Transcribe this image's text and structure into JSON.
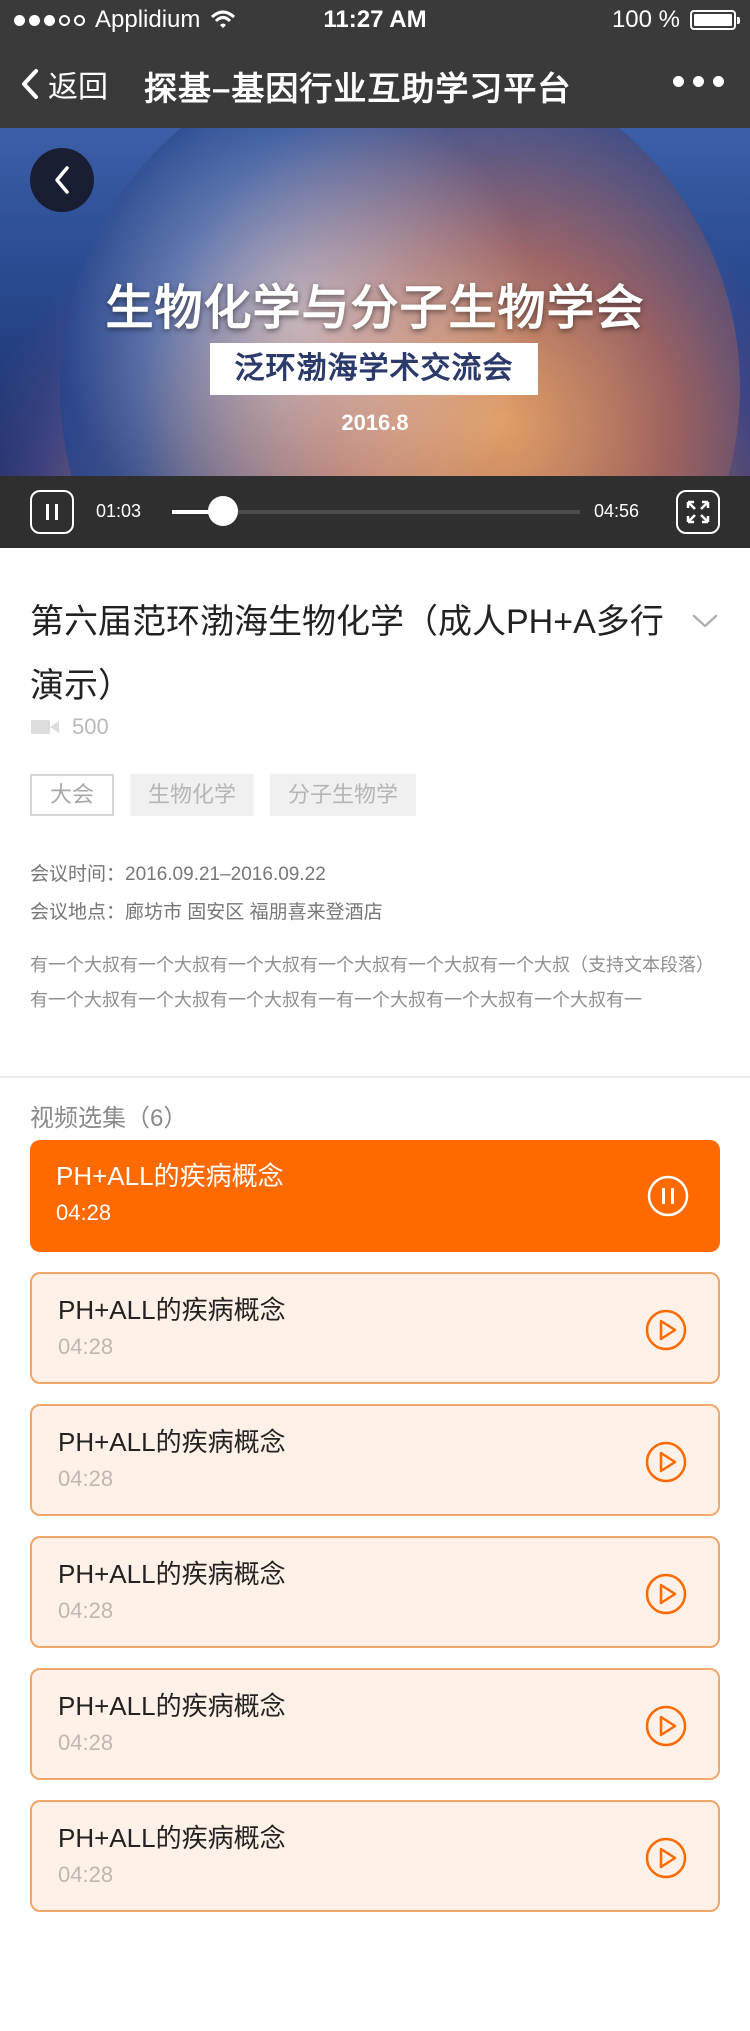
{
  "status_bar": {
    "carrier": "Applidium",
    "time": "11:27 AM",
    "battery": "100 %"
  },
  "nav": {
    "back_label": "返回",
    "title": "探基–基因行业互助学习平台"
  },
  "player": {
    "poster_title": "生物化学与分子生物学会",
    "poster_subtitle": "泛环渤海学术交流会",
    "poster_date": "2016.8",
    "current_time": "01:03",
    "total_time": "04:56",
    "progress_percent": 21
  },
  "video": {
    "title": "第六届范环渤海生物化学（成人PH+A多行演示）",
    "views": "500",
    "tags": [
      "大会",
      "生物化学",
      "分子生物学"
    ],
    "meeting_time_label": "会议时间：",
    "meeting_time": "2016.09.21–2016.09.22",
    "meeting_place_label": "会议地点：",
    "meeting_place": "廊坊市 固安区 福朋喜来登酒店",
    "description": "有一个大叔有一个大叔有一个大叔有一个大叔有一个大叔有一个大叔（支持文本段落）有一个大叔有一个大叔有一个大叔有一有一个大叔有一个大叔有一个大叔有一"
  },
  "episodes": {
    "heading": "视频选集（6）",
    "items": [
      {
        "title": "PH+ALL的疾病概念",
        "duration": "04:28",
        "state": "playing"
      },
      {
        "title": "PH+ALL的疾病概念",
        "duration": "04:28",
        "state": "idle"
      },
      {
        "title": "PH+ALL的疾病概念",
        "duration": "04:28",
        "state": "idle"
      },
      {
        "title": "PH+ALL的疾病概念",
        "duration": "04:28",
        "state": "idle"
      },
      {
        "title": "PH+ALL的疾病概念",
        "duration": "04:28",
        "state": "idle"
      },
      {
        "title": "PH+ALL的疾病概念",
        "duration": "04:28",
        "state": "idle"
      }
    ]
  },
  "colors": {
    "accent": "#ff6a00",
    "episode_bg": "#fff1e7",
    "episode_border": "#f3a669",
    "topbar": "#3a3a3a"
  },
  "icons": {
    "back": "chevron-left-icon",
    "more": "more-dots-icon",
    "pause": "pause-icon",
    "play": "play-icon",
    "fullscreen": "fullscreen-icon",
    "expand": "chevron-down-icon",
    "views": "video-camera-icon"
  }
}
